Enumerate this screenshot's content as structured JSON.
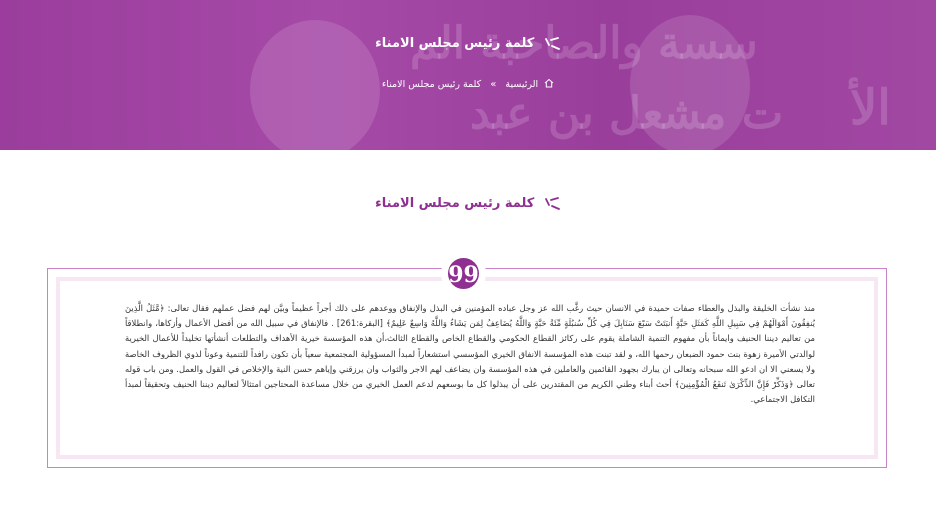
{
  "hero": {
    "title": "كلمة رئيس مجلس الامناء",
    "background_text_1": "سسة والصاحبة الم",
    "background_text_2": "ت مشعل بن عبد",
    "background_text_3": "الأ"
  },
  "breadcrumb": {
    "home_label": "الرئيسية",
    "separator": "»",
    "current_label": "كلمة رئيس مجلس الامناء"
  },
  "section": {
    "title": "كلمة رئيس مجلس الامناء"
  },
  "quote": {
    "badge": "99",
    "text": "منذ نشأت الخليقة والبذل والعطاء صفات حميدة في الانسان حيث رغَّب الله عز وجل عباده المؤمنين في البذل والإنفاق ووعدهم على ذلك أجراً عظيماً وبيَّن لهم فضل عملهم فقال تعالى: ﴿مَّثَلُ الَّذِينَ يُنفِقُونَ أَمْوَالَهُمْ فِي سَبِيلِ اللَّهِ كَمَثَلِ حَبَّةٍ أَنبَتَتْ سَبْعَ سَنَابِلَ فِي كُلِّ سُنبُلَةٍ مِّئَةُ حَبَّةٍ وَاللَّهُ يُضَاعِفُ لِمَن يَشَاءُ وَاللَّهُ وَاسِعٌ عَلِيمٌ﴾ [البقرة:261] . فالإنفاق في سبيل الله من أفضل الأعمال وأزكاها، وانطلاقاً من تعاليم ديننا الحنيف وايماناً بأن مفهوم التنمية الشاملة يقوم على ركائز القطاع الحكومي والقطاع الخاص والقطاع الثالث،أن هذه المؤسسة خيرية الأهداف والتطلعات أنشأتها تخليداً للأعمال الخيرية لوالدتي الأميرة زهوة بنت حمود الضبعان رحمها الله، و لقد تبنت هذه المؤسسة الانفاق الخيري المؤسسي استشعاراً لمبدأ المسؤولية المجتمعية سعياً بأن تكون رافداً للتنمية وعوناً لذوي الظروف الخاصة ولا يسعني الا ان ادعو الله سبحانه وتعالى ان يبارك بجهود القائمين والعاملين في هذه المؤسسة وان يضاعف لهم الاجر والثواب وان يرزقني وإياهم حسن النية والإخلاص في القول والعمل. ومن باب قوله تعالى ﴿وَذَكِّرْ فَإِنَّ الذِّكْرَىٰ تَنفَعُ الْمُؤْمِنِينَ﴾ أحث أبناء وطني الكريم من المقتدرين على أن يبذلوا كل ما بوسعهم لدعم العمل الخيري من خلال مساعدة المحتاجين امتثالاً لتعاليم ديننا الحنيف وتحقيقاً لمبدأ التكافل الاجتماعي."
  },
  "colors": {
    "brand": "#8e2f91",
    "hero_bg": "#a148a3",
    "quote_border": "#c882c9"
  }
}
